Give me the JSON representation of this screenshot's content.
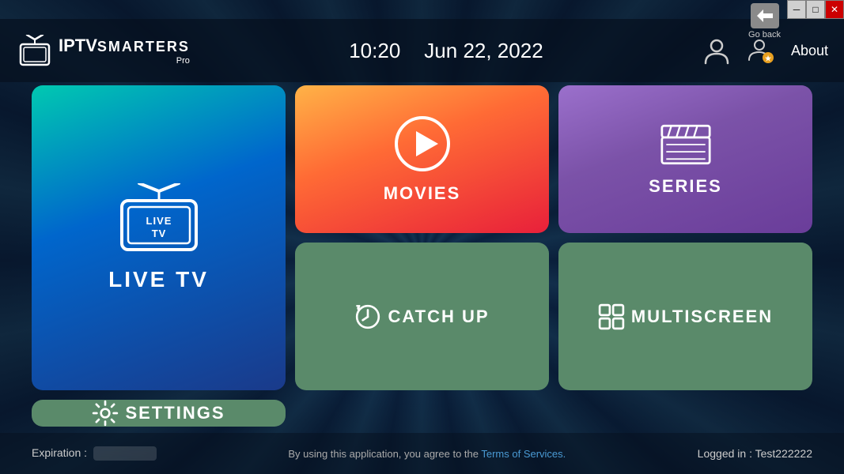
{
  "titlebar": {
    "minimize_label": "─",
    "maximize_label": "□",
    "close_label": "✕"
  },
  "goback": {
    "label": "Go back"
  },
  "header": {
    "logo_iptv": "IPTV",
    "logo_smarters": "SMARTERS",
    "logo_pro": "Pro",
    "time": "10:20",
    "date": "Jun 22, 2022",
    "about_label": "About"
  },
  "tiles": {
    "livetv": {
      "label": "LIVE TV"
    },
    "movies": {
      "label": "MOVIES"
    },
    "series": {
      "label": "SERIES"
    },
    "catchup": {
      "label": "CATCH UP"
    },
    "multiscreen": {
      "label": "MULTISCREEN"
    },
    "settings": {
      "label": "SETTINGS"
    }
  },
  "footer": {
    "expiration_label": "Expiration :",
    "terms_text": "By using this application, you agree to the ",
    "terms_link": "Terms of Services.",
    "logged_in": "Logged in : Test222222"
  }
}
